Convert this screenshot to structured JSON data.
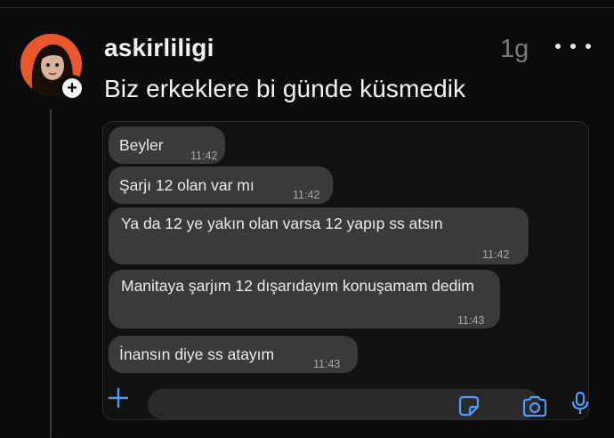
{
  "post": {
    "username": "askirliligi",
    "time": "1g",
    "text": "Biz erkeklere bi günde küsmedik",
    "follow_symbol": "+"
  },
  "chat": {
    "messages": [
      {
        "text": "Beyler",
        "time": "11:42"
      },
      {
        "text": "Şarjı 12 olan var mı",
        "time": "11:42"
      },
      {
        "text": "Ya da 12 ye yakın olan varsa 12 yapıp ss atsın",
        "time": "11:42"
      },
      {
        "text": "Manitaya şarjım 12 dışarıdayım konuşamam dedim",
        "time": "11:43"
      },
      {
        "text": "İnansın diye ss atayım",
        "time": "11:43"
      }
    ]
  },
  "icons": [
    "more-icon",
    "follow-plus-icon",
    "add-attachment-icon",
    "sticker-icon",
    "camera-icon",
    "microphone-icon"
  ],
  "colors": {
    "background": "#0b0b0c",
    "bubble": "#3a3a3c",
    "muted_text": "#7a7a7d",
    "avatar_bg": "#e8562b"
  }
}
